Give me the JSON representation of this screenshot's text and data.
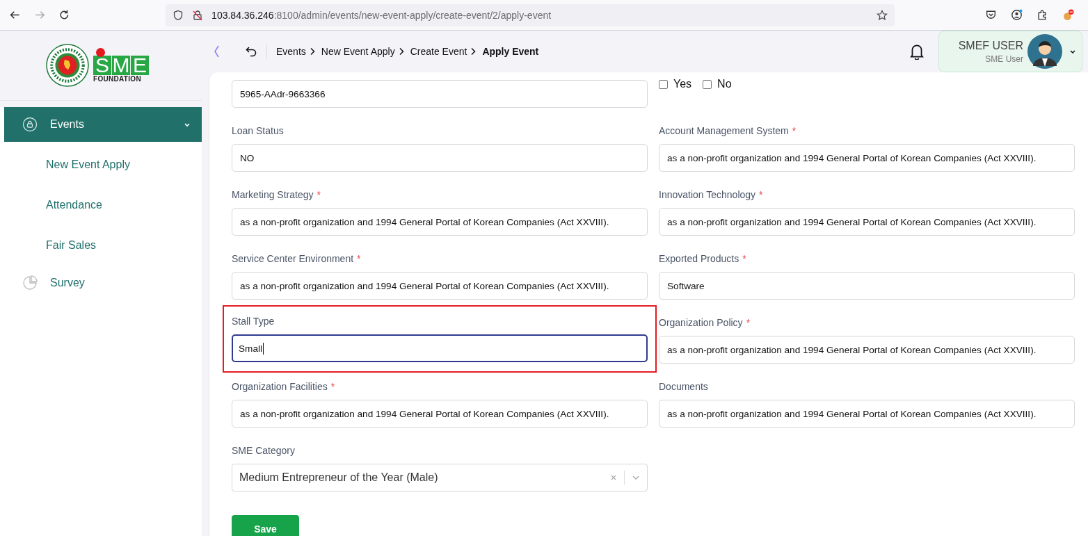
{
  "browser": {
    "url_host": "103.84.36.246",
    "url_rest": ":8100/admin/events/new-event-apply/create-event/2/apply-event"
  },
  "logo": {
    "letters": [
      "S",
      "M",
      "E"
    ],
    "tagline": "FOUNDATION"
  },
  "sidebar": {
    "items": [
      {
        "label": "Events",
        "kind": "group",
        "selected": true,
        "expanded": true,
        "children": [
          {
            "label": "New Event Apply"
          },
          {
            "label": "Attendance"
          },
          {
            "label": "Fair Sales"
          }
        ]
      },
      {
        "label": "Survey",
        "kind": "link",
        "selected": false
      }
    ]
  },
  "breadcrumbs": [
    {
      "label": "Events",
      "current": false
    },
    {
      "label": "New Event Apply",
      "current": false
    },
    {
      "label": "Create Event",
      "current": false
    },
    {
      "label": "Apply Event",
      "current": true
    }
  ],
  "user": {
    "name": "SMEF USER",
    "role": "SME User"
  },
  "form": {
    "fields": [
      {
        "kind": "text",
        "value": "5965-AAdr-9663366",
        "highlighted": false,
        "focused": false
      },
      {
        "kind": "checkboxes",
        "options": [
          {
            "label": "Yes",
            "checked": false
          },
          {
            "label": "No",
            "checked": false
          }
        ]
      },
      {
        "kind": "text",
        "label": "Loan Status",
        "value": "NO",
        "highlighted": false,
        "focused": false
      },
      {
        "kind": "text",
        "label": "Account Management System",
        "required_mark": "*",
        "value": "as a non-profit organization and 1994 General Portal of Korean Companies (Act XXVIII).",
        "highlighted": false,
        "focused": false
      },
      {
        "kind": "text",
        "label": "Marketing Strategy",
        "required_mark": "*",
        "value": "as a non-profit organization and 1994 General Portal of Korean Companies (Act XXVIII).",
        "highlighted": false,
        "focused": false
      },
      {
        "kind": "text",
        "label": "Innovation Technology",
        "required_mark": "*",
        "value": "as a non-profit organization and 1994 General Portal of Korean Companies (Act XXVIII).",
        "highlighted": false,
        "focused": false
      },
      {
        "kind": "text",
        "label": "Service Center Environment",
        "required_mark": "*",
        "value": "as a non-profit organization and 1994 General Portal of Korean Companies (Act XXVIII).",
        "highlighted": false,
        "focused": false
      },
      {
        "kind": "text",
        "label": "Exported Products",
        "required_mark": "*",
        "value": "Software",
        "highlighted": false,
        "focused": false
      },
      {
        "kind": "text",
        "label": "Stall Type",
        "value": "Small",
        "highlighted": true,
        "focused": true
      },
      {
        "kind": "text",
        "label": "Organization Policy",
        "required_mark": "*",
        "value": "as a non-profit organization and 1994 General Portal of Korean Companies (Act XXVIII).",
        "highlighted": false,
        "focused": false
      },
      {
        "kind": "text",
        "label": "Organization Facilities",
        "required_mark": "*",
        "value": "as a non-profit organization and 1994 General Portal of Korean Companies (Act XXVIII).",
        "highlighted": false,
        "focused": false
      },
      {
        "kind": "text",
        "label": "Documents",
        "value": "as a non-profit organization and 1994 General Portal of Korean Companies (Act XXVIII).",
        "highlighted": false,
        "focused": false
      },
      {
        "kind": "select",
        "label": "SME Category",
        "value": "Medium Entrepreneur of the Year (Male)"
      }
    ],
    "save": "Save"
  }
}
